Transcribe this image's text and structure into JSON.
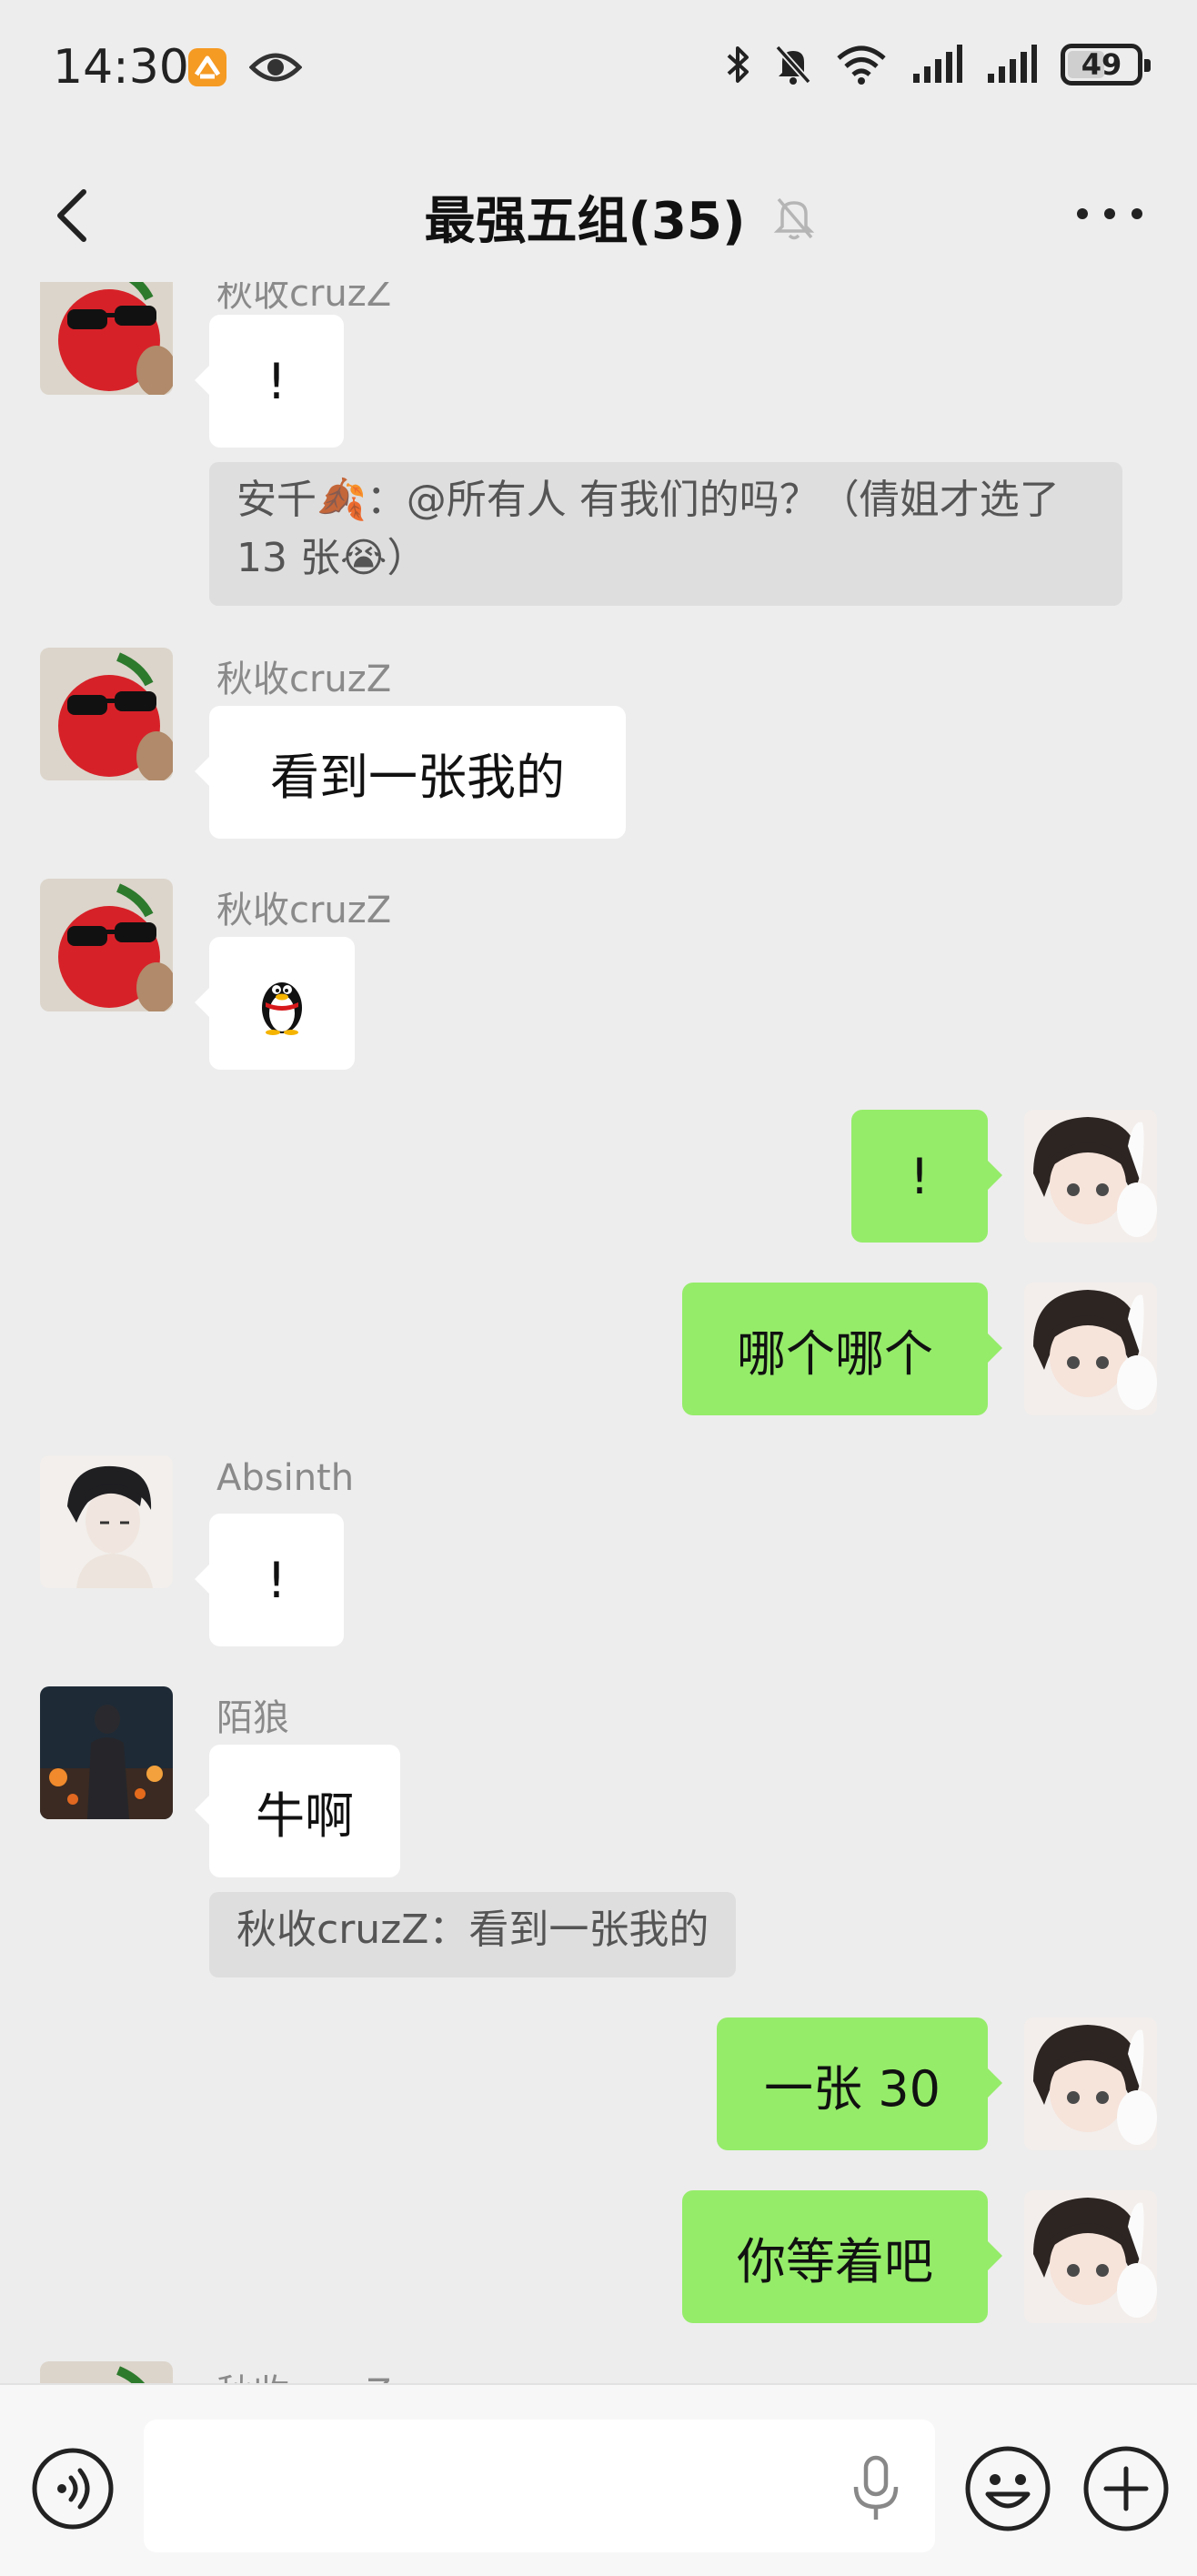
{
  "status_bar": {
    "time": "14:30",
    "battery": "49"
  },
  "header": {
    "title": "最强五组(35)"
  },
  "messages": [
    {
      "sender": "秋收cruzZ",
      "text": "!"
    },
    {
      "quote": "安千🍂：@所有人 有我们的吗？（倩姐才选了 13 张😭）"
    },
    {
      "sender": "秋收cruzZ",
      "text": "看到一张我的"
    },
    {
      "sender": "秋收cruzZ",
      "sticker": "penguin-emoji"
    },
    {
      "self": true,
      "text": "!"
    },
    {
      "self": true,
      "text": "哪个哪个"
    },
    {
      "sender": "Absinth",
      "text": "!"
    },
    {
      "sender": "陌狼",
      "text": "牛啊"
    },
    {
      "quote": "秋收cruzZ：看到一张我的"
    },
    {
      "self": true,
      "text": "一张 30"
    },
    {
      "self": true,
      "text": "你等着吧"
    },
    {
      "sender": "秋收cruzZ"
    }
  ],
  "input_bar": {
    "placeholder": ""
  },
  "colors": {
    "background": "#ededed",
    "outgoing_bubble": "#95ec69",
    "incoming_bubble": "#ffffff",
    "quote_bg": "#dedede"
  },
  "icons": [
    "app-notification-icon",
    "eye-icon",
    "bluetooth-icon",
    "mute-bell-icon",
    "wifi-icon",
    "signal-icon",
    "back-arrow-icon",
    "muted-bell-icon",
    "more-icon",
    "voice-icon",
    "mic-icon",
    "emoji-icon",
    "plus-icon"
  ]
}
